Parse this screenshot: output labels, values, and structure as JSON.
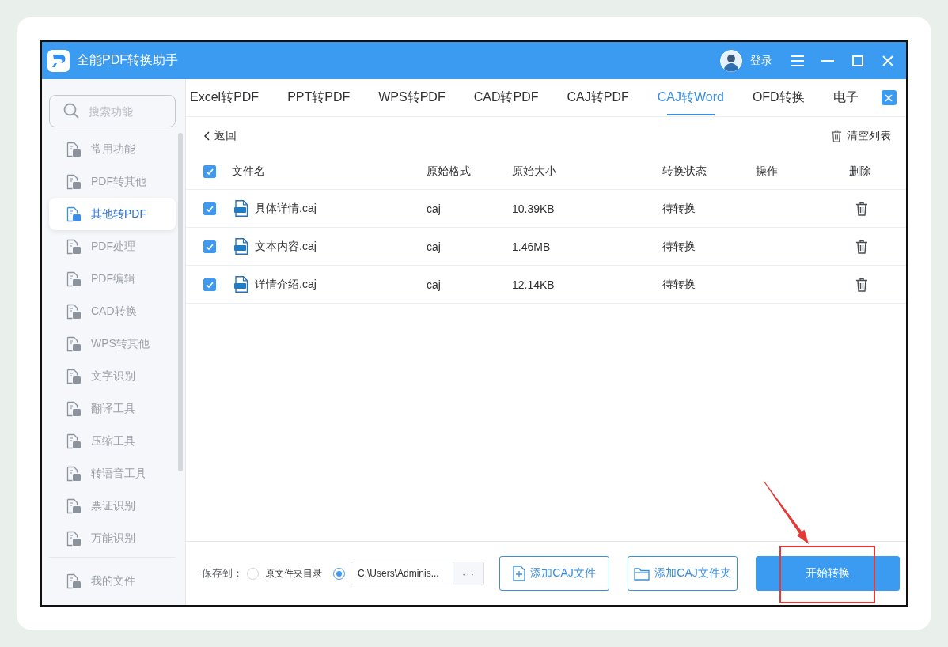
{
  "window": {
    "title": "全能PDF转换助手",
    "login": "登录"
  },
  "sidebar": {
    "search": {
      "placeholder": "搜索功能"
    },
    "items": [
      {
        "label": "常用功能",
        "selected": false
      },
      {
        "label": "PDF转其他",
        "selected": false
      },
      {
        "label": "其他转PDF",
        "selected": true
      },
      {
        "label": "PDF处理",
        "selected": false
      },
      {
        "label": "PDF编辑",
        "selected": false
      },
      {
        "label": "CAD转换",
        "selected": false
      },
      {
        "label": "WPS转其他",
        "selected": false
      },
      {
        "label": "文字识别",
        "selected": false
      },
      {
        "label": "翻译工具",
        "selected": false
      },
      {
        "label": "压缩工具",
        "selected": false
      },
      {
        "label": "转语音工具",
        "selected": false
      },
      {
        "label": "票证识别",
        "selected": false
      },
      {
        "label": "万能识别",
        "selected": false
      }
    ],
    "footer_items": [
      {
        "label": "我的文件",
        "selected": false
      }
    ]
  },
  "tabs": [
    {
      "label": "Excel转PDF",
      "selected": false
    },
    {
      "label": "PPT转PDF",
      "selected": false
    },
    {
      "label": "WPS转PDF",
      "selected": false
    },
    {
      "label": "CAD转PDF",
      "selected": false
    },
    {
      "label": "CAJ转PDF",
      "selected": false
    },
    {
      "label": "CAJ转Word",
      "selected": true
    },
    {
      "label": "OFD转换",
      "selected": false
    },
    {
      "label": "电子",
      "selected": false
    }
  ],
  "toolbar": {
    "back": "返回",
    "clear": "清空列表"
  },
  "table": {
    "all_checked": true,
    "columns": [
      "文件名",
      "原始格式",
      "原始大小",
      "转换状态",
      "操作",
      "删除"
    ],
    "rows": [
      {
        "checked": true,
        "name": "具体详情.caj",
        "format": "caj",
        "size": "10.39KB",
        "status": "待转换"
      },
      {
        "checked": true,
        "name": "文本内容.caj",
        "format": "caj",
        "size": "1.46MB",
        "status": "待转换"
      },
      {
        "checked": true,
        "name": "详情介绍.caj",
        "format": "caj",
        "size": "12.14KB",
        "status": "待转换"
      }
    ]
  },
  "save_bar": {
    "label": "保存到：",
    "destinations": [
      {
        "kind": "option",
        "label": "原文件夹目录",
        "selected": false
      },
      {
        "kind": "path",
        "value": "C:\\Users\\Adminis...",
        "browse": "···",
        "selected": true
      }
    ]
  },
  "buttons": [
    {
      "kind": "add_file",
      "label": "添加CAJ文件"
    },
    {
      "kind": "add_folder",
      "label": "添加CAJ文件夹"
    },
    {
      "kind": "primary",
      "label": "开始转换"
    }
  ]
}
